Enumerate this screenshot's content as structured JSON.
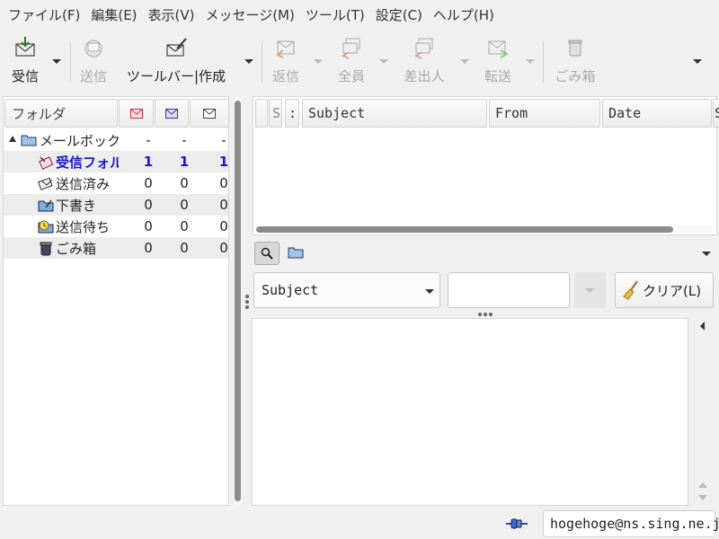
{
  "menubar": {
    "items": [
      {
        "label": "ファイル(F)"
      },
      {
        "label": "編集(E)"
      },
      {
        "label": "表示(V)"
      },
      {
        "label": "メッセージ(M)"
      },
      {
        "label": "ツール(T)"
      },
      {
        "label": "設定(C)"
      },
      {
        "label": "ヘルプ(H)"
      }
    ]
  },
  "toolbar": {
    "receive_label": "受信",
    "send_label": "送信",
    "compose_label": "ツールバー|作成",
    "reply_label": "返信",
    "reply_all_label": "全員",
    "reply_sender_label": "差出人",
    "forward_label": "転送",
    "trash_label": "ごみ箱"
  },
  "folder_pane": {
    "header": {
      "folder_col": "フォルダ"
    },
    "mailbox": {
      "name": "メールボックス",
      "new": "-",
      "unread": "-",
      "total": "-"
    },
    "folders": [
      {
        "name": "受信フォルダ",
        "new": "1",
        "unread": "1",
        "total": "1",
        "active": true
      },
      {
        "name": "送信済み",
        "new": "0",
        "unread": "0",
        "total": "0"
      },
      {
        "name": "下書き",
        "new": "0",
        "unread": "0",
        "total": "0"
      },
      {
        "name": "送信待ち",
        "new": "0",
        "unread": "0",
        "total": "0"
      },
      {
        "name": "ごみ箱",
        "new": "0",
        "unread": "0",
        "total": "0"
      }
    ]
  },
  "message_list": {
    "columns": {
      "mark": "",
      "status": "S",
      "attach": ":",
      "subject": "Subject",
      "from": "From",
      "date": "Date",
      "size": "S"
    }
  },
  "search": {
    "field_selected": "Subject",
    "query": "",
    "clear_label": "クリア(L)"
  },
  "statusbar": {
    "account": "hogehoge@ns.sing.ne.jp"
  },
  "colors": {
    "active_folder": "#1a1acc",
    "background": "#f0f0f0"
  }
}
